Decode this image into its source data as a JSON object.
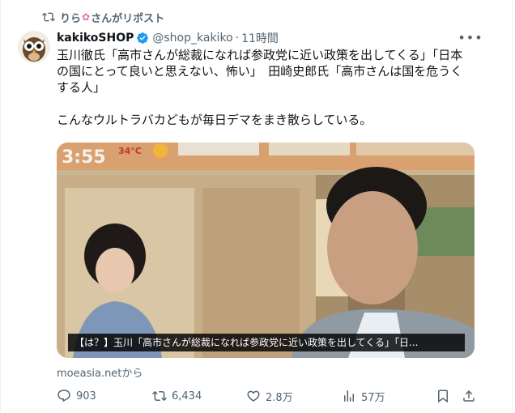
{
  "repost": {
    "user": "りら",
    "suffix": "さんがリポスト"
  },
  "author": {
    "name": "kakikoSHOP",
    "handle": "@shop_kakiko",
    "separator": "·",
    "time": "11時間"
  },
  "text": {
    "line1": "玉川徹氏「高市さんが総裁になれば参政党に近い政策を出してくる」「日本",
    "line2": "の国にとって良いと思えない、怖い」　田崎史郎氏「高市さんは国を危うく",
    "line3": "する人」",
    "line4": "こんなウルトラバカどもが毎日デマをまき散らしている。"
  },
  "media": {
    "overlay_clock": "3:55",
    "overlay_temp": "34°C",
    "caption": "【は？】玉川「高市さんが総裁になれば参政党に近い政策を出してくる」「日..."
  },
  "source": "moeasia.netから",
  "actions": {
    "replies": "903",
    "reposts": "6,434",
    "likes": "2.8万",
    "views": "57万"
  },
  "colors": {
    "text": "#0f1419",
    "muted": "#536471",
    "verified": "#1d9bf0"
  }
}
